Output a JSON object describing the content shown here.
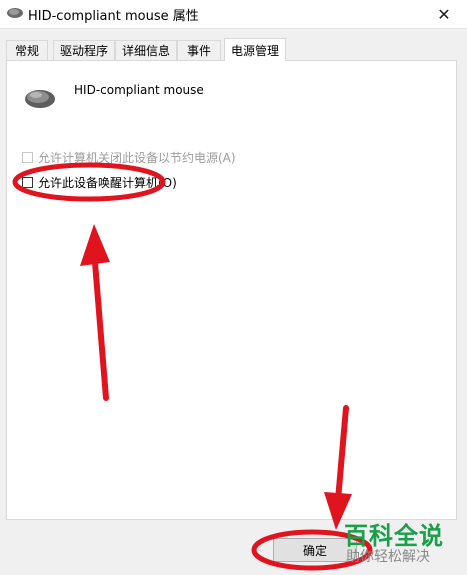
{
  "window": {
    "title": "HID-compliant mouse 属性",
    "close_glyph": "✕"
  },
  "tabs": [
    {
      "label": "常规"
    },
    {
      "label": "驱动程序"
    },
    {
      "label": "详细信息"
    },
    {
      "label": "事件"
    },
    {
      "label": "电源管理",
      "active": true
    }
  ],
  "device": {
    "name": "HID-compliant mouse",
    "icon": "mouse-icon"
  },
  "options": {
    "allow_power_off": {
      "label": "允许计算机关闭此设备以节约电源(A)",
      "checked": false,
      "enabled": false
    },
    "allow_wake": {
      "label": "允许此设备唤醒计算机(O)",
      "checked": false,
      "enabled": true
    }
  },
  "buttons": {
    "ok": "确定"
  },
  "watermark": {
    "title": "百科全说",
    "subtitle": "助你轻松解决"
  },
  "colors": {
    "annotation_red": "#e0141e",
    "watermark_green": "#1a9f4a"
  }
}
